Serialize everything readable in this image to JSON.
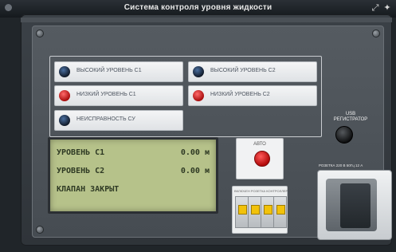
{
  "window": {
    "title": "Система контроля уровня жидкости"
  },
  "indicators": [
    {
      "label": "ВЫСОКИЙ УРОВЕНЬ С1",
      "lamp": "blue"
    },
    {
      "label": "ВЫСОКИЙ УРОВЕНЬ С2",
      "lamp": "blue"
    },
    {
      "label": "НИЗКИЙ УРОВЕНЬ С1",
      "lamp": "red"
    },
    {
      "label": "НИЗКИЙ УРОВЕНЬ С2",
      "lamp": "red"
    },
    {
      "label": "НЕИСПРАВНОСТЬ СУ",
      "lamp": "blue"
    }
  ],
  "display": {
    "rows": [
      {
        "label": "УРОВЕНЬ С1",
        "value": "0.00 м"
      },
      {
        "label": "УРОВЕНЬ С2",
        "value": "0.00 м"
      },
      {
        "label": "КЛАПАН ЗАКРЫТ",
        "value": ""
      }
    ]
  },
  "auto": {
    "label": "АВТО"
  },
  "breakers": {
    "label": "ВКЛЮЧЕН РОЗЕТКА  КОНТРОЛЛЕР",
    "count": 4
  },
  "usb": {
    "label_line1": "USB",
    "label_line2": "РЕГИСТРАТОР"
  },
  "socket": {
    "label": "РОЗЕТКА  220 В  50Гц  12 А"
  },
  "colors": {
    "lamp_red": "#e01616",
    "lamp_blue": "#1c2f4d",
    "lcd": "#b6c28a"
  }
}
